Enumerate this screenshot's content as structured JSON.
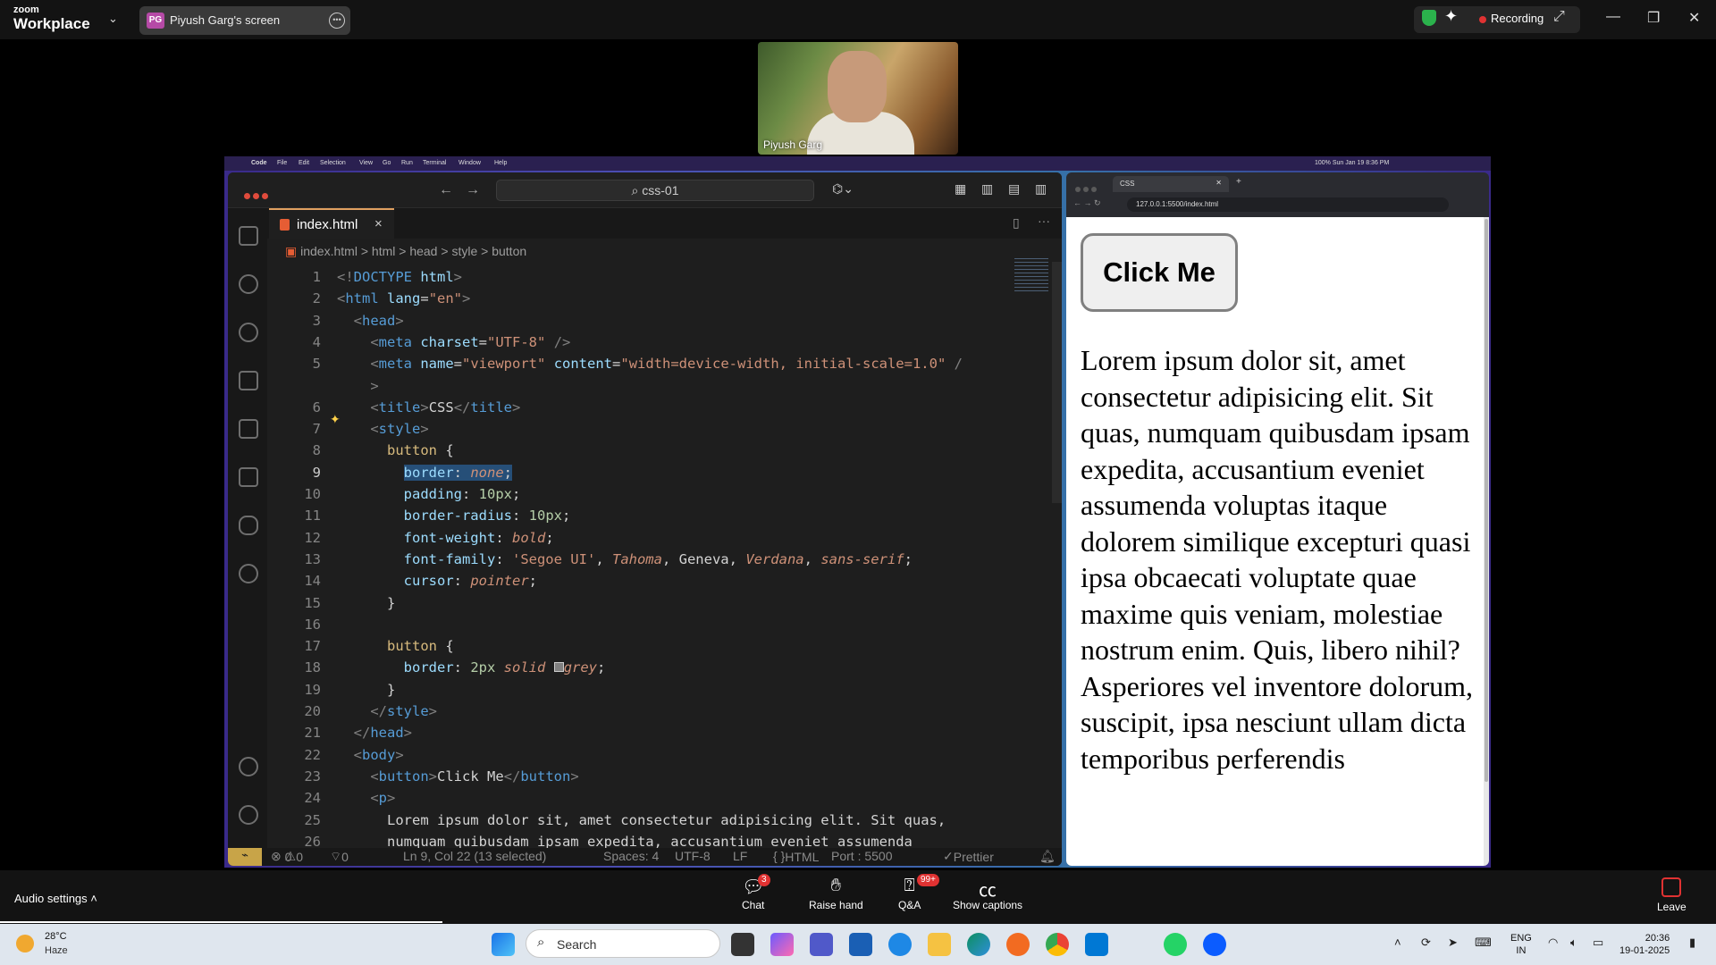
{
  "zoom": {
    "brand_small": "zoom",
    "brand_big": "Workplace",
    "share_pill": {
      "avatar": "PG",
      "label": "Piyush Garg's screen"
    },
    "recording_label": "Recording",
    "video": {
      "name": "Piyush Garg"
    },
    "bottom": {
      "audio_label": "Audio settings",
      "buttons": [
        {
          "label": "Chat",
          "badge": "3"
        },
        {
          "label": "Raise hand"
        },
        {
          "label": "Q&A",
          "badge": "99+"
        },
        {
          "label": "Show captions"
        }
      ],
      "leave_label": "Leave"
    }
  },
  "mac_menubar": {
    "items": [
      "Code",
      "File",
      "Edit",
      "Selection",
      "View",
      "Go",
      "Run",
      "Terminal",
      "Window",
      "Help"
    ],
    "right": "100%   Sun Jan 19  8:36 PM"
  },
  "vscode": {
    "search_text": "css-01",
    "tab": "index.html",
    "breadcrumb": [
      "index.html",
      "html",
      "head",
      "style",
      "button"
    ],
    "lines": [
      {
        "n": "1",
        "html": "<span class='p'>&lt;!</span><span class='t'>DOCTYPE</span> <span class='at'>html</span><span class='p'>&gt;</span>"
      },
      {
        "n": "2",
        "html": "<span class='p'>&lt;</span><span class='t'>html</span> <span class='at'>lang</span>=<span class='s'>\"en\"</span><span class='p'>&gt;</span>"
      },
      {
        "n": "3",
        "html": "  <span class='p'>&lt;</span><span class='t'>head</span><span class='p'>&gt;</span>"
      },
      {
        "n": "4",
        "html": "    <span class='p'>&lt;</span><span class='t'>meta</span> <span class='at'>charset</span>=<span class='s'>\"UTF-8\"</span> <span class='p'>/&gt;</span>"
      },
      {
        "n": "5",
        "html": "    <span class='p'>&lt;</span><span class='t'>meta</span> <span class='at'>name</span>=<span class='s'>\"viewport\"</span> <span class='at'>content</span>=<span class='s'>\"width=device-width, initial-scale=1.0\"</span> <span class='p'>/</span>"
      },
      {
        "n": "",
        "html": "    <span class='p'>&gt;</span>"
      },
      {
        "n": "6",
        "html": "    <span class='p'>&lt;</span><span class='t'>title</span><span class='p'>&gt;</span>CSS<span class='p'>&lt;/</span><span class='t'>title</span><span class='p'>&gt;</span>"
      },
      {
        "n": "7",
        "html": "    <span class='p'>&lt;</span><span class='t'>style</span><span class='p'>&gt;</span>"
      },
      {
        "n": "8",
        "html": "      <span class='sel'>button</span> {"
      },
      {
        "n": "9",
        "html": "        <span class='selbg'><span class='pr'>border</span>: <span class='v'>none</span>;</span>"
      },
      {
        "n": "10",
        "html": "        <span class='pr'>padding</span>: <span class='n'>10px</span>;"
      },
      {
        "n": "11",
        "html": "        <span class='pr'>border-radius</span>: <span class='n'>10px</span>;"
      },
      {
        "n": "12",
        "html": "        <span class='pr'>font-weight</span>: <span class='v'>bold</span>;"
      },
      {
        "n": "13",
        "html": "        <span class='pr'>font-family</span>: <span class='s'>'Segoe UI'</span>, <span class='v'>Tahoma</span>, Geneva, <span class='v'>Verdana</span>, <span class='v'>sans-serif</span>;"
      },
      {
        "n": "14",
        "html": "        <span class='pr'>cursor</span>: <span class='v'>pointer</span>;"
      },
      {
        "n": "15",
        "html": "      }"
      },
      {
        "n": "16",
        "html": ""
      },
      {
        "n": "17",
        "html": "      <span class='sel'>button</span> {"
      },
      {
        "n": "18",
        "html": "        <span class='pr'>border</span>: <span class='n'>2px</span> <span class='v'>solid</span> <span style='display:inline-block;width:11px;height:11px;background:#808080;border:1px solid #ccc'></span><span class='v'>grey</span>;"
      },
      {
        "n": "19",
        "html": "      }"
      },
      {
        "n": "20",
        "html": "    <span class='p'>&lt;/</span><span class='t'>style</span><span class='p'>&gt;</span>"
      },
      {
        "n": "21",
        "html": "  <span class='p'>&lt;/</span><span class='t'>head</span><span class='p'>&gt;</span>"
      },
      {
        "n": "22",
        "html": "  <span class='p'>&lt;</span><span class='t'>body</span><span class='p'>&gt;</span>"
      },
      {
        "n": "23",
        "html": "    <span class='p'>&lt;</span><span class='t'>button</span><span class='p'>&gt;</span>Click Me<span class='p'>&lt;/</span><span class='t'>button</span><span class='p'>&gt;</span>"
      },
      {
        "n": "24",
        "html": "    <span class='p'>&lt;</span><span class='t'>p</span><span class='p'>&gt;</span>"
      },
      {
        "n": "25",
        "html": "      Lorem ipsum dolor sit, amet consectetur adipisicing elit. Sit quas,"
      },
      {
        "n": "26",
        "html": "      numquam quibusdam ipsam expedita, accusantium eveniet assumenda"
      }
    ],
    "status": {
      "errors": "0",
      "warnings": "0",
      "ports": "0",
      "position": "Ln 9, Col 22 (13 selected)",
      "spaces": "Spaces: 4",
      "encoding": "UTF-8",
      "eol": "LF",
      "language": "HTML",
      "port": "Port : 5500",
      "prettier": "Prettier"
    }
  },
  "browser": {
    "tab_title": "CSS",
    "url": "127.0.0.1:5500/index.html",
    "button_label": "Click Me",
    "paragraph": "Lorem ipsum dolor sit, amet consectetur adipisicing elit. Sit quas, numquam quibusdam ipsam expedita, accusantium eveniet assumenda voluptas itaque dolorem similique excepturi quasi ipsa obcaecati voluptate quae maxime quis veniam, molestiae nostrum enim. Quis, libero nihil? Asperiores vel inventore dolorum, suscipit, ipsa nesciunt ullam dicta temporibus perferendis"
  },
  "taskbar": {
    "weather_temp": "28°C",
    "weather_desc": "Haze",
    "search_label": "Search",
    "lang_top": "ENG",
    "lang_bottom": "IN",
    "time": "20:36",
    "date": "19-01-2025"
  }
}
